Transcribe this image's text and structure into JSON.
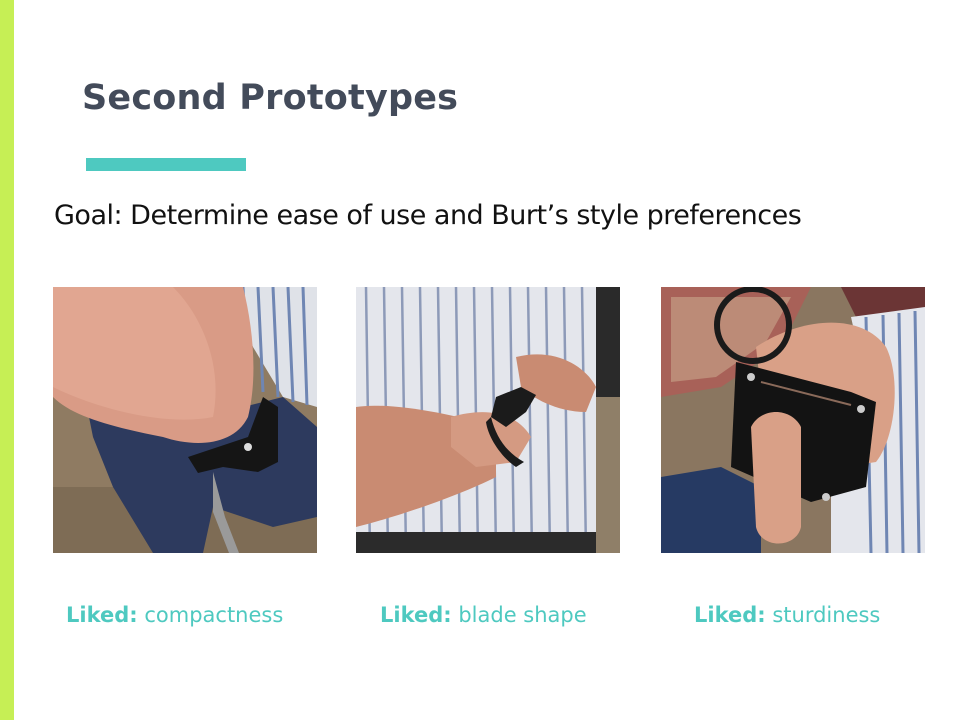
{
  "slide": {
    "title": "Second Prototypes",
    "goal": "Goal: Determine ease of use and Burt’s style preferences",
    "accent_color": "#c6ef55",
    "highlight_color": "#4ec9c0"
  },
  "photos": [
    {
      "caption_label": "Liked:",
      "caption_text": "compactness"
    },
    {
      "caption_label": "Liked:",
      "caption_text": "blade shape"
    },
    {
      "caption_label": "Liked:",
      "caption_text": "sturdiness"
    }
  ]
}
